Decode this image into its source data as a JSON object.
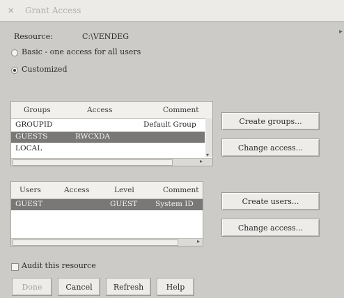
{
  "window": {
    "title": "Grant Access",
    "menu_icon": "menu-icon"
  },
  "resource": {
    "label": "Resource:",
    "value": "C:\\VENDEG"
  },
  "mode": {
    "basic_label": "Basic - one access for all users",
    "customized_label": "Customized",
    "selected": "customized"
  },
  "groups": {
    "headers": {
      "name": "Groups",
      "access": "Access",
      "comment": "Comment"
    },
    "rows": [
      {
        "name": "GROUPID",
        "access": "",
        "comment": "Default Group",
        "selected": false
      },
      {
        "name": "GUESTS",
        "access": "RWCXDA",
        "comment": "",
        "selected": true
      },
      {
        "name": "LOCAL",
        "access": "",
        "comment": "",
        "selected": false
      }
    ],
    "create_label": "Create groups...",
    "change_label": "Change access..."
  },
  "users": {
    "headers": {
      "name": "Users",
      "access": "Access",
      "level": "Level",
      "comment": "Comment"
    },
    "rows": [
      {
        "name": "GUEST",
        "access": "",
        "level": "GUEST",
        "comment": "System ID",
        "selected": true
      }
    ],
    "create_label": "Create users...",
    "change_label": "Change access..."
  },
  "audit": {
    "label": "Audit this resource",
    "checked": false
  },
  "footer": {
    "done_label": "Done",
    "cancel_label": "Cancel",
    "refresh_label": "Refresh",
    "help_label": "Help"
  }
}
